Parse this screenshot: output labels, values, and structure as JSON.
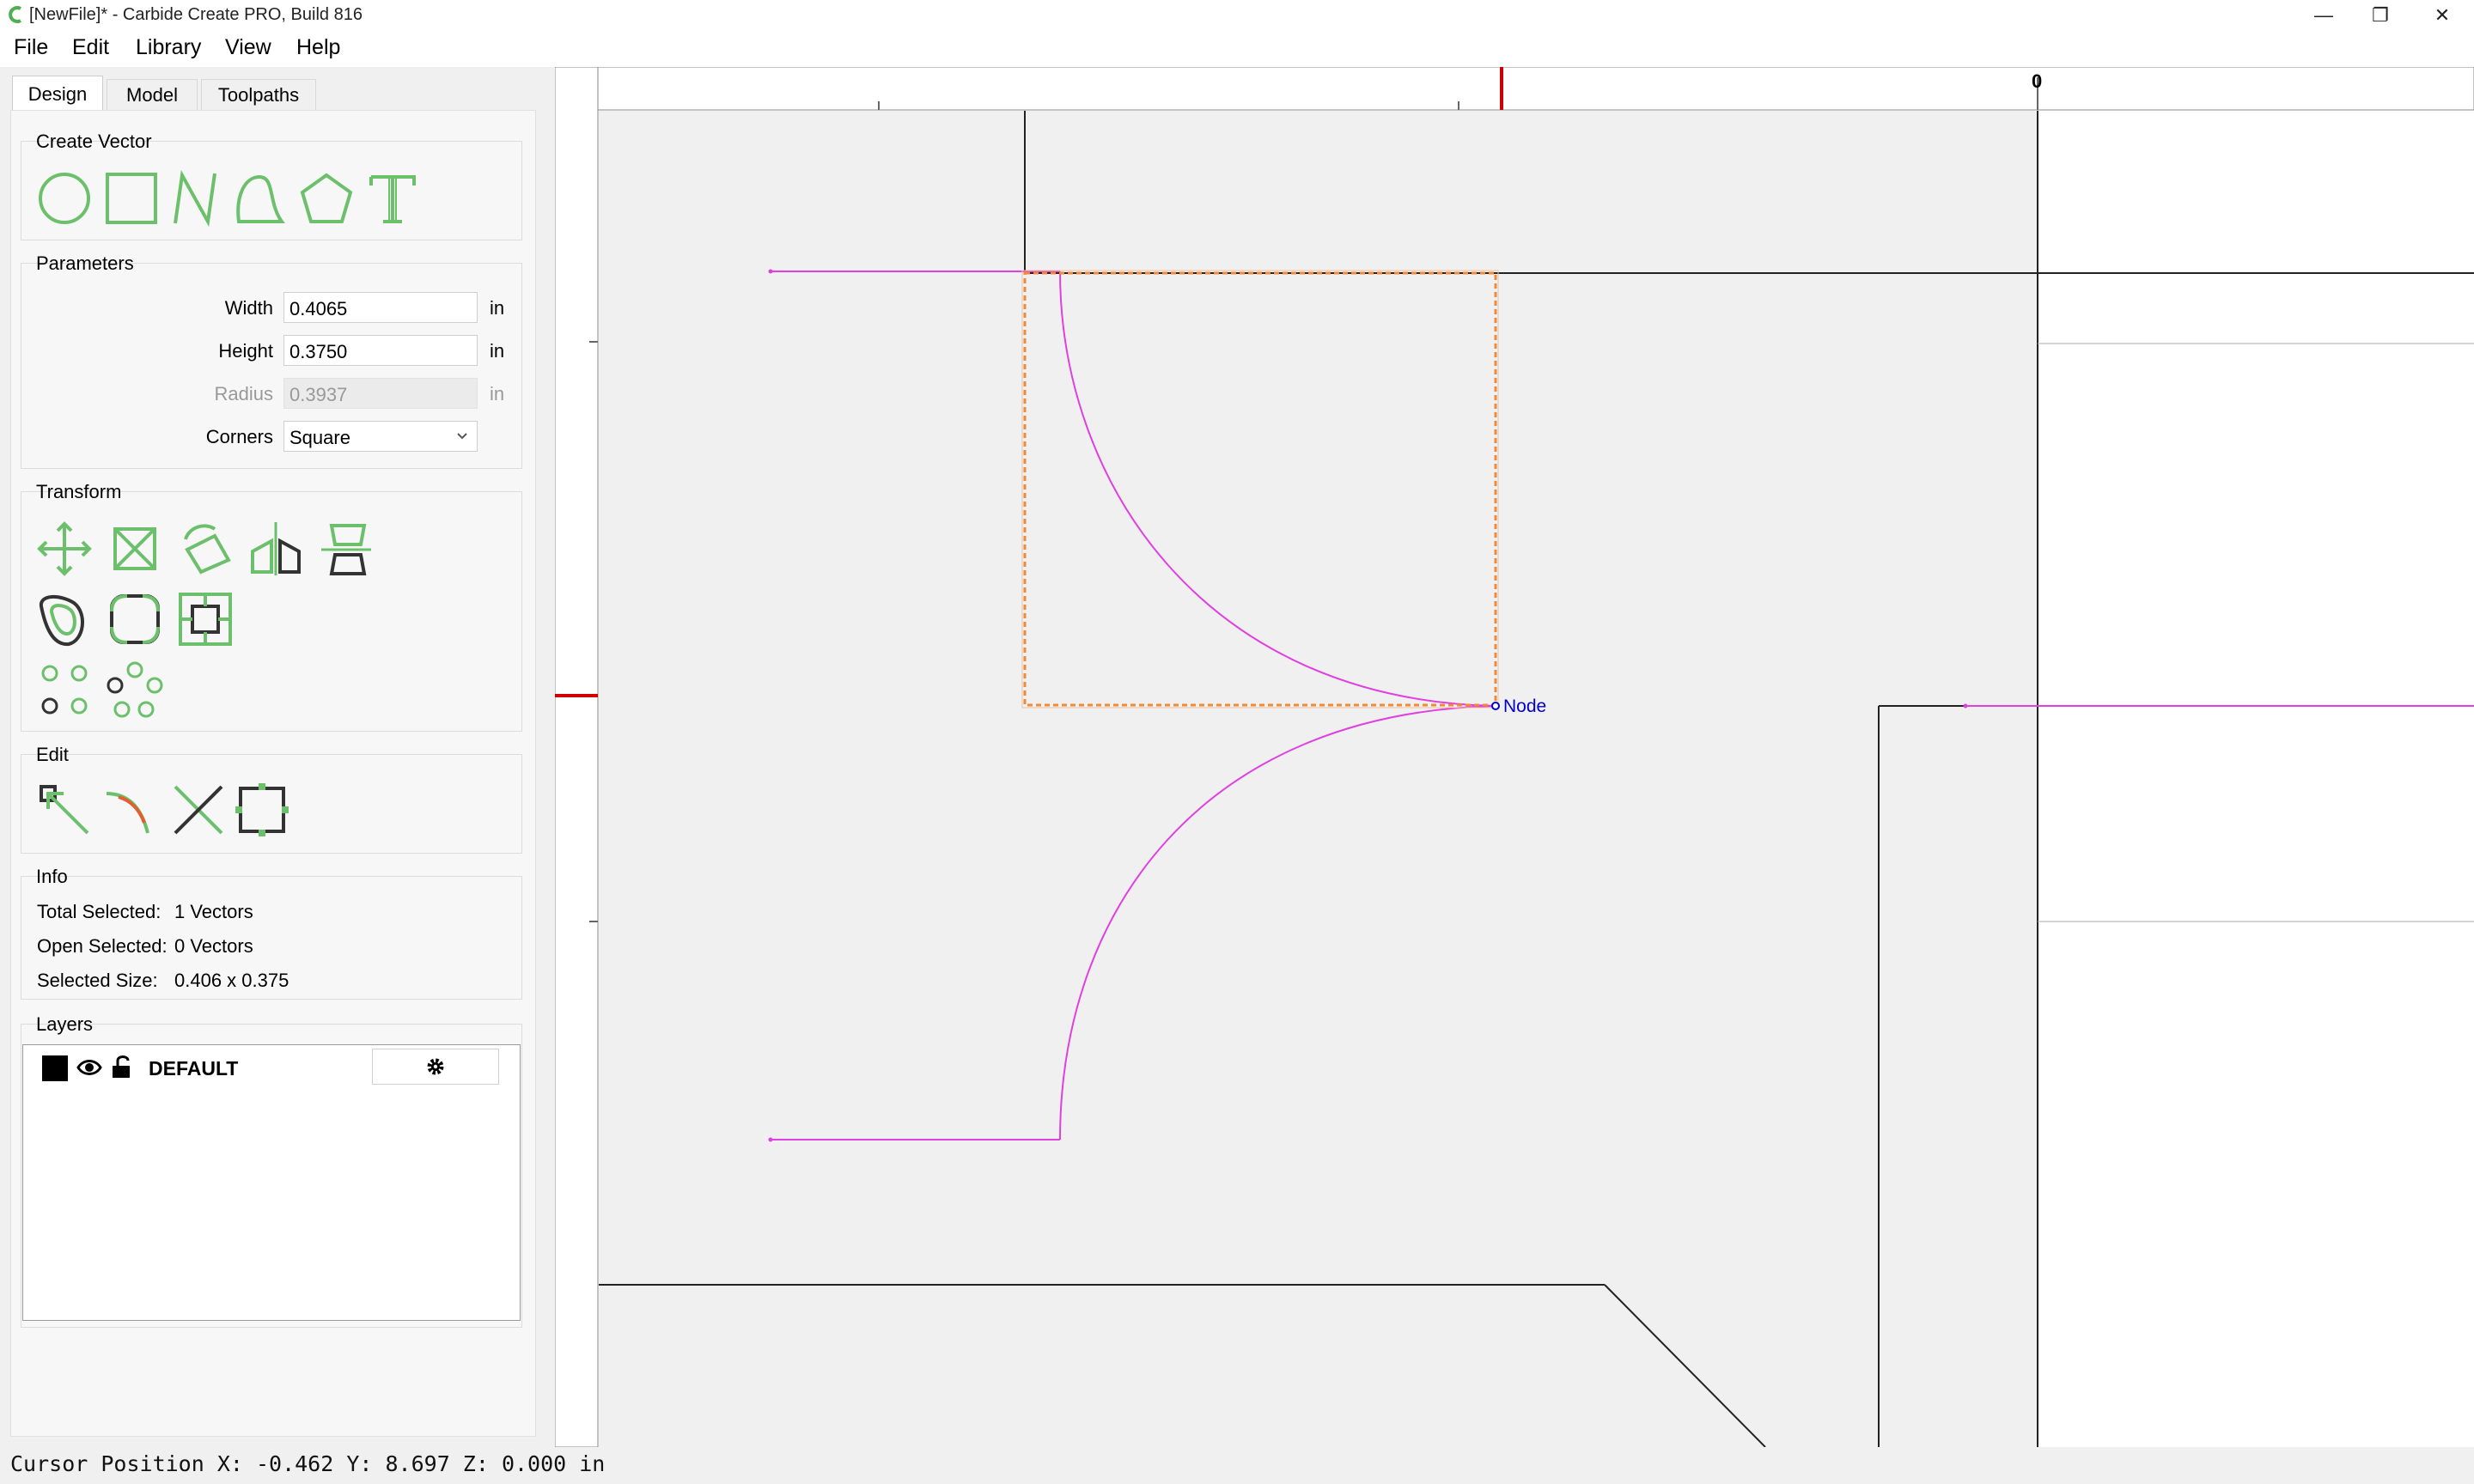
{
  "window": {
    "title": "[NewFile]* - Carbide Create PRO, Build 816",
    "minimize_glyph": "—",
    "restore_glyph": "❐",
    "close_glyph": "✕"
  },
  "menu": [
    "File",
    "Edit",
    "Library",
    "View",
    "Help"
  ],
  "tabs": [
    "Design",
    "Model",
    "Toolpaths"
  ],
  "create_vector": {
    "title": "Create Vector",
    "tools": [
      "circle-icon",
      "rectangle-icon",
      "polyline-icon",
      "curve-icon",
      "polygon-icon",
      "text-icon"
    ]
  },
  "parameters": {
    "title": "Parameters",
    "width_label": "Width",
    "width_value": "0.4065",
    "height_label": "Height",
    "height_value": "0.3750",
    "radius_label": "Radius",
    "radius_value": "0.3937",
    "corners_label": "Corners",
    "corners_value": "Square",
    "unit": "in"
  },
  "transform": {
    "title": "Transform"
  },
  "edit": {
    "title": "Edit"
  },
  "info": {
    "title": "Info",
    "total_selected_label": "Total Selected:",
    "total_selected_value": "1 Vectors",
    "open_selected_label": "Open Selected:",
    "open_selected_value": "0 Vectors",
    "selected_size_label": "Selected Size:",
    "selected_size_value": "0.406 x 0.375"
  },
  "layers": {
    "title": "Layers",
    "items": [
      {
        "name": "DEFAULT",
        "color": "#000000"
      }
    ]
  },
  "canvas": {
    "ruler_zero": "0",
    "node_label": "Node",
    "colors": {
      "vector": "#e040e0",
      "selection": "#ee8a3a",
      "node": "#0000cc",
      "cursor_marker": "#d00000"
    }
  },
  "status": {
    "cursor_position": "Cursor Position X: -0.462 Y: 8.697 Z: 0.000 in"
  },
  "accent_color": "#6cc06c"
}
